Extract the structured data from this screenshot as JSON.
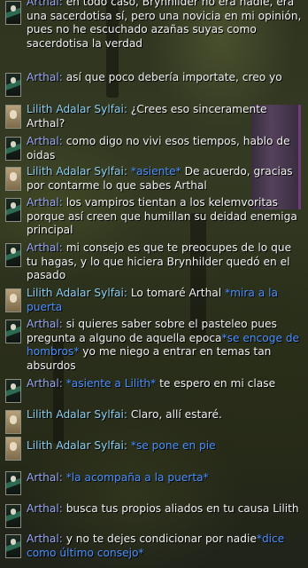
{
  "speakers": {
    "arthal": "Arthal:",
    "lilith": "Lilith Adalar Sylfai:"
  },
  "messages": [
    {
      "who": "arthal",
      "parts": [
        {
          "t": "en todo caso, Brynhilder no era nadie, era una sacerdotisa sí, pero una novicia en mi opinión, pues no he escuchado azañas suyas como sacerdotisa la verdad"
        }
      ]
    },
    {
      "who": "arthal",
      "parts": [
        {
          "t": "así que poco debería importate, creo yo"
        }
      ]
    },
    {
      "who": "lilith",
      "parts": [
        {
          "t": "¿Crees eso sinceramente Arthal?"
        }
      ]
    },
    {
      "who": "arthal",
      "parts": [
        {
          "t": "como digo no vivi esos tiempos, hablo de oidas"
        }
      ]
    },
    {
      "who": "lilith",
      "parts": [
        {
          "t": "*asiente*",
          "e": true
        },
        {
          "t": " De acuerdo, gracias por contarme lo que sabes Arthal"
        }
      ]
    },
    {
      "who": "arthal",
      "parts": [
        {
          "t": "los vampiros tientan a los kelemvoritas porque así creen que humillan su deidad enemiga principal"
        }
      ]
    },
    {
      "who": "arthal",
      "parts": [
        {
          "t": "mi consejo es que te preocupes de lo que tu hagas, y lo que hiciera Brynhilder quedó en el pasado"
        }
      ]
    },
    {
      "who": "lilith",
      "parts": [
        {
          "t": "Lo tomaré Arthal "
        },
        {
          "t": "*mira a la puerta",
          "e": true
        }
      ]
    },
    {
      "who": "arthal",
      "parts": [
        {
          "t": "si quieres saber sobre el pasteleo pues pregunta a alguno de aquella epoca"
        },
        {
          "t": "*se encoge de hombros*",
          "e": true
        },
        {
          "t": " yo me niego a entrar en temas tan absurdos"
        }
      ]
    },
    {
      "who": "arthal",
      "parts": [
        {
          "t": "*asiente a Lilith*",
          "e": true
        },
        {
          "t": " te espero en mi clase"
        }
      ]
    },
    {
      "who": "lilith",
      "parts": [
        {
          "t": "Claro, allí estaré."
        }
      ]
    },
    {
      "who": "lilith",
      "parts": [
        {
          "t": "*se pone en pie",
          "e": true
        }
      ]
    },
    {
      "who": "arthal",
      "parts": [
        {
          "t": "*la acompaña a la  puerta*",
          "e": true
        }
      ]
    },
    {
      "who": "arthal",
      "parts": [
        {
          "t": "busca tus propios aliados en tu causa Lilith"
        }
      ]
    },
    {
      "who": "arthal",
      "parts": [
        {
          "t": "y no te dejes condicionar por nadie"
        },
        {
          "t": "*dice como último consejo*",
          "e": true
        }
      ]
    }
  ]
}
